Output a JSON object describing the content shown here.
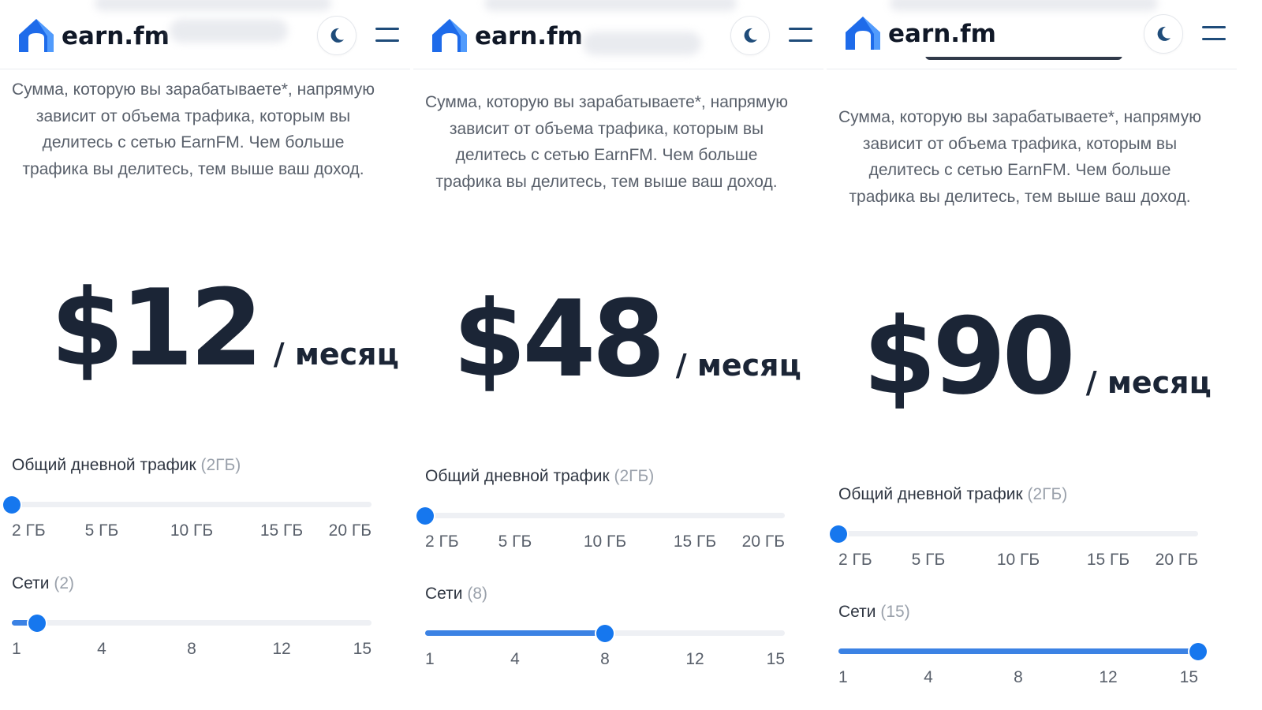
{
  "brand": {
    "name": "earn.fm",
    "colors": {
      "logo_primary": "#1e6bea",
      "logo_secondary": "#5aa3ff",
      "menu": "#1f4c7a",
      "accent": "#1677ee"
    }
  },
  "header_icons": {
    "theme": "moon-icon",
    "menu": "hamburger-menu-icon"
  },
  "panels": [
    {
      "description": "Сумма, которую вы зарабатываете*, напрямую зависит от объема трафика, которым вы делитесь с сетью EarnFM. Чем больше трафика вы делитесь, тем выше ваш доход.",
      "price": "$12",
      "period": "/ месяц",
      "traffic": {
        "label": "Общий дневной трафик",
        "value_text": "(2ГБ)",
        "ticks": [
          "2 ГБ",
          "5 ГБ",
          "10 ГБ",
          "15 ГБ",
          "20 ГБ"
        ],
        "level": 0.0
      },
      "networks": {
        "label": "Сети",
        "value_text": "(2)",
        "ticks": [
          "1",
          "4",
          "8",
          "12",
          "15"
        ],
        "level": 0.07
      }
    },
    {
      "description": "Сумма, которую вы зарабатываете*, напрямую зависит от объема трафика, которым вы делитесь с сетью EarnFM. Чем больше трафика вы делитесь, тем выше ваш доход.",
      "price": "$48",
      "period": "/ месяц",
      "traffic": {
        "label": "Общий дневной трафик",
        "value_text": "(2ГБ)",
        "ticks": [
          "2 ГБ",
          "5 ГБ",
          "10 ГБ",
          "15 ГБ",
          "20 ГБ"
        ],
        "level": 0.0
      },
      "networks": {
        "label": "Сети",
        "value_text": "(8)",
        "ticks": [
          "1",
          "4",
          "8",
          "12",
          "15"
        ],
        "level": 0.5
      }
    },
    {
      "description": "Сумма, которую вы зарабатываете*, напрямую зависит от объема трафика, которым вы делитесь с сетью EarnFM. Чем больше трафика вы делитесь, тем выше ваш доход.",
      "price": "$90",
      "period": "/ месяц",
      "traffic": {
        "label": "Общий дневной трафик",
        "value_text": "(2ГБ)",
        "ticks": [
          "2 ГБ",
          "5 ГБ",
          "10 ГБ",
          "15 ГБ",
          "20 ГБ"
        ],
        "level": 0.0
      },
      "networks": {
        "label": "Сети",
        "value_text": "(15)",
        "ticks": [
          "1",
          "4",
          "8",
          "12",
          "15"
        ],
        "level": 1.0
      }
    }
  ]
}
